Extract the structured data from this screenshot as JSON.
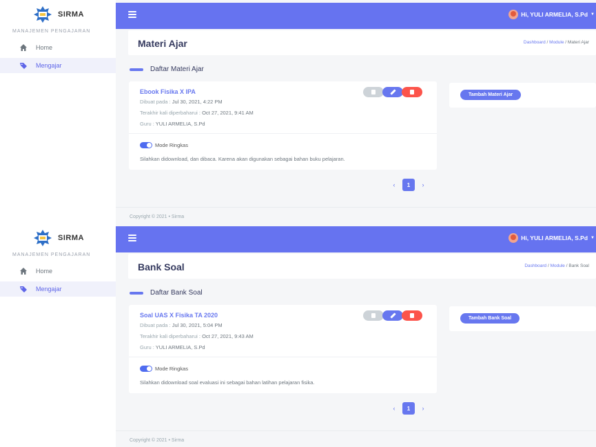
{
  "colors": {
    "accent": "#6777ef",
    "topbar": "#6673f0",
    "danger": "#fc544b",
    "muted": "#cdd3d8"
  },
  "brand": {
    "name": "SIRMA"
  },
  "sidebar": {
    "section_label": "MANAJEMEN PENGAJARAN",
    "items": [
      {
        "label": "Home",
        "icon": "home-icon"
      },
      {
        "label": "Mengajar",
        "icon": "tag-icon"
      }
    ]
  },
  "topbar": {
    "user_greeting": "Hi, YULI ARMELIA, S.Pd"
  },
  "breadcrumb": {
    "dashboard": "Dashboard",
    "module": "Module",
    "separator": "/"
  },
  "footer": {
    "text": "Copyright © 2021 • Sirma"
  },
  "pagination": {
    "prev": "‹",
    "current": "1",
    "next": "›"
  },
  "screens": [
    {
      "page_title": "Materi Ajar",
      "breadcrumb_current": "Materi Ajar",
      "section_heading": "Daftar Materi Ajar",
      "add_button": "Tambah Materi Ajar",
      "item": {
        "title": "Ebook Fisika X IPA",
        "created_label": "Dibuat pada :",
        "created_value": "Jul 30, 2021, 4:22 PM",
        "updated_label": "Terakhir kali diperbaharui :",
        "updated_value": "Oct 27, 2021, 9:41 AM",
        "guru_label": "Guru :",
        "guru_value": "YULI ARMELIA, S.Pd",
        "toggle_label": "Mode Ringkas",
        "description": "Silahkan didownload, dan dibaca. Karena akan digunakan sebagai bahan buku pelajaran."
      }
    },
    {
      "page_title": "Bank Soal",
      "breadcrumb_current": "Bank Soal",
      "section_heading": "Daftar Bank Soal",
      "add_button": "Tambah Bank Soal",
      "item": {
        "title": "Soal UAS X Fisika TA 2020",
        "created_label": "Dibuat pada :",
        "created_value": "Jul 30, 2021, 5:04 PM",
        "updated_label": "Terakhir kali diperbaharui :",
        "updated_value": "Oct 27, 2021, 9:43 AM",
        "guru_label": "Guru :",
        "guru_value": "YULI ARMELIA, S.Pd",
        "toggle_label": "Mode Ringkas",
        "description": "Silahkan didownload soal evaluasi ini sebagai bahan latihan pelajaran fisika."
      }
    }
  ]
}
